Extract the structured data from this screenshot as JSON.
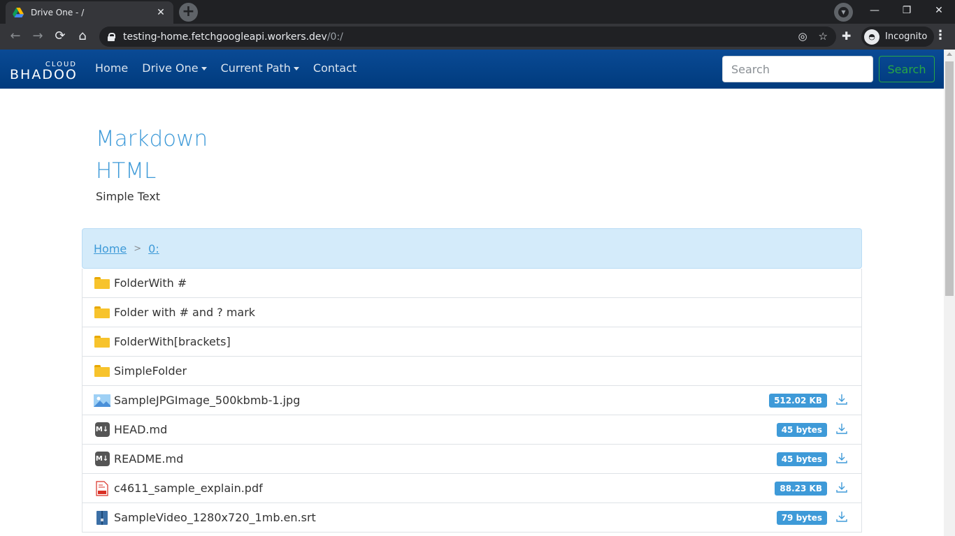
{
  "browser": {
    "tab_title": "Drive One - /",
    "tab_close": "✕",
    "new_tab": "+",
    "window_controls": {
      "minimize": "—",
      "restore": "❐",
      "close": "✕"
    },
    "url_host": "testing-home.fetchgoogleapi.workers.dev",
    "url_path": "/0:/",
    "profile_label": "Incognito"
  },
  "navbar": {
    "brand_top": "CLOUD",
    "brand_main": "BHADOO",
    "links": [
      "Home",
      "Drive One",
      "Current Path",
      "Contact"
    ],
    "search_placeholder": "Search",
    "search_button": "Search"
  },
  "readme": {
    "heading1": "Markdown",
    "heading2": "HTML",
    "text": "Simple Text"
  },
  "breadcrumb": {
    "items": [
      "Home",
      "0:"
    ],
    "separator": ">"
  },
  "files": [
    {
      "name": "FolderWith #",
      "type": "folder"
    },
    {
      "name": "Folder with # and ? mark",
      "type": "folder"
    },
    {
      "name": "FolderWith[brackets]",
      "type": "folder"
    },
    {
      "name": "SimpleFolder",
      "type": "folder"
    },
    {
      "name": "SampleJPGImage_500kbmb-1.jpg",
      "type": "image",
      "size": "512.02 KB"
    },
    {
      "name": "HEAD.md",
      "type": "markdown",
      "size": "45 bytes"
    },
    {
      "name": "README.md",
      "type": "markdown",
      "size": "45 bytes"
    },
    {
      "name": "c4611_sample_explain.pdf",
      "type": "pdf",
      "size": "88.23 KB"
    },
    {
      "name": "SampleVideo_1280x720_1mb.en.srt",
      "type": "archive",
      "size": "79 bytes"
    }
  ],
  "colors": {
    "navbar": "#0a4a95",
    "link": "#3e9ad8",
    "badge": "#3e9ad8",
    "search_btn": "#28a745",
    "breadcrumb_bg": "#d4ebfa"
  }
}
